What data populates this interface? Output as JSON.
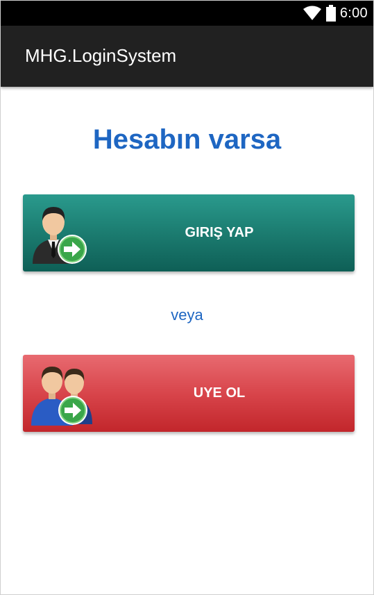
{
  "status_bar": {
    "time": "6:00",
    "icons": [
      "wifi-icon",
      "battery-icon"
    ]
  },
  "app_bar": {
    "title": "MHG.LoginSystem"
  },
  "main": {
    "heading": "Hesabın varsa",
    "login_button": {
      "label": "GIRIŞ YAP",
      "icon": "user-login-icon"
    },
    "separator": "veya",
    "register_button": {
      "label": "UYE OL",
      "icon": "users-add-icon"
    }
  },
  "colors": {
    "accent_blue": "#1e66c2",
    "login_green": "#1d7f73",
    "register_red": "#d8454b",
    "app_bar": "#212121"
  }
}
